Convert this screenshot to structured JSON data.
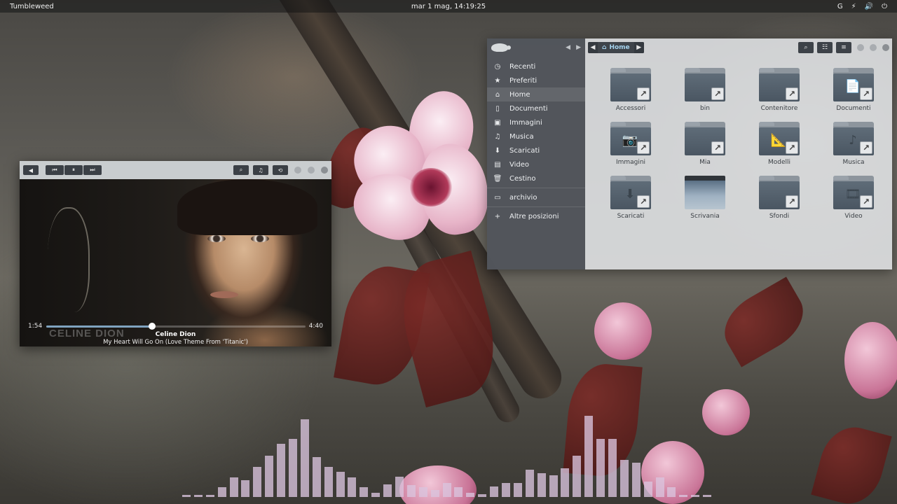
{
  "topbar": {
    "activities": "Tumbleweed",
    "clock": "mar 1 mag, 14:19:25",
    "keyboard": "G",
    "icons": [
      "network-icon",
      "volume-icon",
      "power-icon"
    ]
  },
  "files": {
    "path": [
      "Home"
    ],
    "sidebar": [
      {
        "label": "Recenti",
        "icon": "clock-icon"
      },
      {
        "label": "Preferiti",
        "icon": "star-icon"
      },
      {
        "label": "Home",
        "icon": "home-icon",
        "active": true
      },
      {
        "label": "Documenti",
        "icon": "document-icon"
      },
      {
        "label": "Immagini",
        "icon": "image-icon"
      },
      {
        "label": "Musica",
        "icon": "music-icon"
      },
      {
        "label": "Scaricati",
        "icon": "download-icon"
      },
      {
        "label": "Video",
        "icon": "video-icon"
      },
      {
        "label": "Cestino",
        "icon": "trash-icon"
      },
      {
        "label": "archivio",
        "icon": "drive-icon"
      },
      {
        "label": "Altre posizioni",
        "icon": "plus-icon"
      }
    ],
    "items": [
      {
        "label": "Accessori",
        "symbol": ""
      },
      {
        "label": "bin",
        "symbol": ""
      },
      {
        "label": "Contenitore",
        "symbol": ""
      },
      {
        "label": "Documenti",
        "symbol": "📄"
      },
      {
        "label": "Immagini",
        "symbol": "📷"
      },
      {
        "label": "Mia",
        "symbol": ""
      },
      {
        "label": "Modelli",
        "symbol": "📐"
      },
      {
        "label": "Musica",
        "symbol": "♪"
      },
      {
        "label": "Scaricati",
        "symbol": "⬇"
      },
      {
        "label": "Scrivania",
        "symbol": "",
        "desktop": true
      },
      {
        "label": "Sfondi",
        "symbol": ""
      },
      {
        "label": "Video",
        "symbol": "🎞"
      }
    ]
  },
  "player": {
    "elapsed": "1:54",
    "duration": "4:40",
    "progress": 0.407,
    "artist": "Celine Dion",
    "track": "My Heart Will Go On (Love Theme From 'Titanic')",
    "cover_text": "CELINE DION"
  },
  "visualizer": {
    "levels": [
      0.02,
      0.02,
      0.02,
      0.1,
      0.2,
      0.17,
      0.31,
      0.42,
      0.54,
      0.59,
      0.79,
      0.41,
      0.31,
      0.26,
      0.2,
      0.1,
      0.04,
      0.13,
      0.21,
      0.12,
      0.1,
      0.07,
      0.14,
      0.1,
      0.04,
      0.03,
      0.11,
      0.14,
      0.14,
      0.28,
      0.24,
      0.22,
      0.29,
      0.42,
      0.83,
      0.59,
      0.59,
      0.38,
      0.35,
      0.16,
      0.2,
      0.1,
      0.02,
      0.02,
      0.02
    ],
    "color": "#dac4de"
  }
}
